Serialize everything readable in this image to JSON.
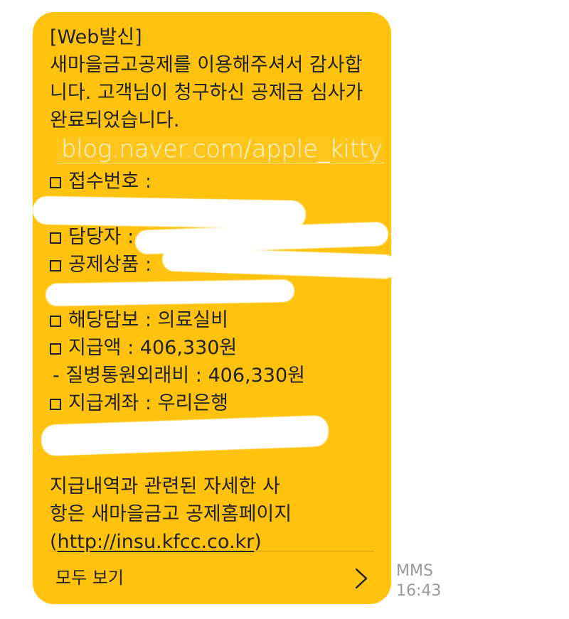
{
  "message": {
    "lines": [
      "[Web발신]",
      "새마을금고공제를 이용해주셔서 감사합",
      "니다. 고객님이 청구하신 공제금 심사가",
      "완료되었습니다."
    ],
    "watermark": "blog.naver.com/apple_kitty",
    "receipt_label": "접수번호 :",
    "manager_label": "담당자 :",
    "product_label": "공제상품 :",
    "coverage_label": "해당담보 : 의료실비",
    "amount_label": "지급액 : 406,330원",
    "sub_amount_label": "- 질병통원외래비 : 406,330원",
    "account_label": "지급계좌 : 우리은행",
    "footer_line1": "지급내역과 관련된 자세한 사",
    "footer_line2": "항은 새마을금고 공제홈페이지",
    "footer_open": "(",
    "footer_link": "http://insu.kfcc.co.kr",
    "footer_close": ")"
  },
  "view_all": {
    "label": "모두 보기",
    "icon": "chevron-right-icon"
  },
  "meta": {
    "type": "MMS",
    "time": "16:43"
  },
  "colors": {
    "bubble": "#FFC20E",
    "text": "#222222",
    "meta": "#9a9a9a"
  }
}
